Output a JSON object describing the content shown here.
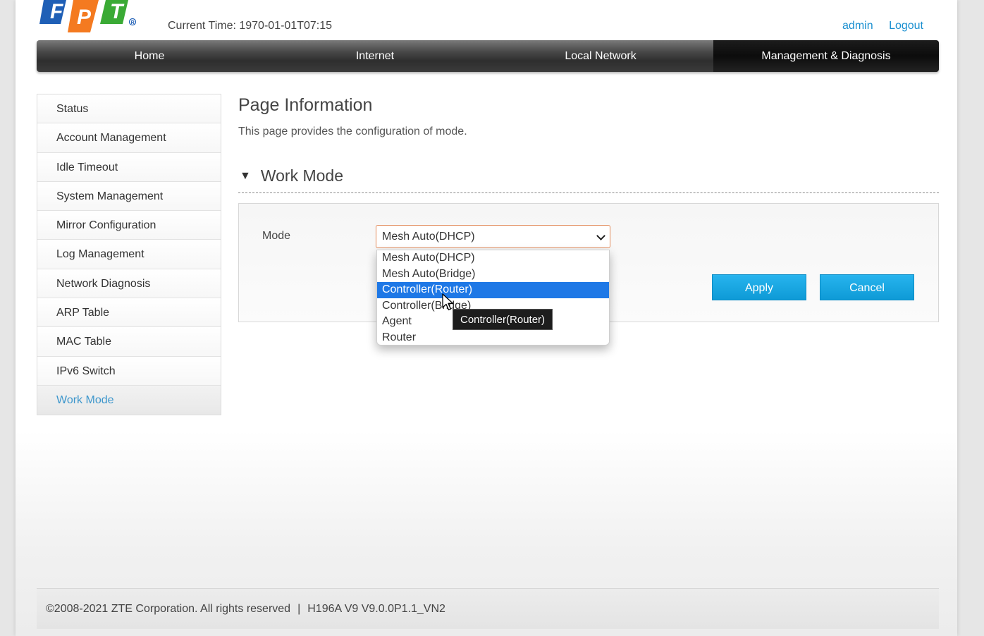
{
  "brand": {
    "logo_text": "FPT",
    "colors": {
      "blue": "#1f5fb6",
      "orange": "#f47a20",
      "green": "#3aaa35"
    }
  },
  "header": {
    "current_time": "Current Time: 1970-01-01T07:15",
    "user": "admin",
    "logout": "Logout"
  },
  "nav": {
    "items": [
      {
        "label": "Home"
      },
      {
        "label": "Internet"
      },
      {
        "label": "Local Network"
      },
      {
        "label": "Management & Diagnosis"
      }
    ],
    "active": "Management & Diagnosis"
  },
  "sidebar": {
    "items": [
      {
        "label": "Status"
      },
      {
        "label": "Account Management"
      },
      {
        "label": "Idle Timeout"
      },
      {
        "label": "System Management"
      },
      {
        "label": "Mirror Configuration"
      },
      {
        "label": "Log Management"
      },
      {
        "label": "Network Diagnosis"
      },
      {
        "label": "ARP Table"
      },
      {
        "label": "MAC Table"
      },
      {
        "label": "IPv6 Switch"
      },
      {
        "label": "Work Mode"
      }
    ],
    "active": "Work Mode"
  },
  "main": {
    "title": "Page Information",
    "description": "This page provides the configuration of mode.",
    "section_title": "Work Mode",
    "form": {
      "mode_label": "Mode",
      "mode_value": "Mesh Auto(DHCP)",
      "options": [
        "Mesh Auto(DHCP)",
        "Mesh Auto(Bridge)",
        "Controller(Router)",
        "Controller(Bridge)",
        "Agent",
        "Router"
      ],
      "highlighted_option": "Controller(Router)",
      "tooltip": "Controller(Router)",
      "apply_label": "Apply",
      "cancel_label": "Cancel"
    }
  },
  "footer": {
    "copyright": "©2008-2021 ZTE Corporation. All rights reserved",
    "separator": "|",
    "version": "H196A V9 V9.0.0P1.1_VN2"
  }
}
